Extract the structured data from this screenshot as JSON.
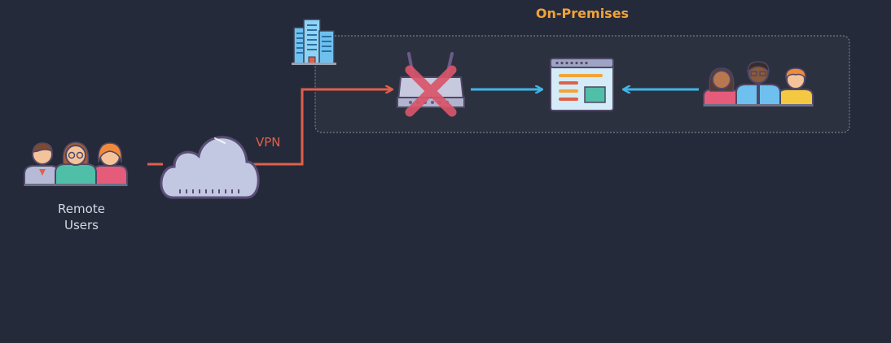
{
  "diagram": {
    "title": "On-Premises",
    "vpn_label": "VPN",
    "remote_users": {
      "line1": "Remote",
      "line2": "Users"
    }
  },
  "colors": {
    "background": "#252a3a",
    "title": "#f2a33a",
    "vpn_path": "#e0604a",
    "internal_arrows": "#3fb6e6",
    "region_border": "#8a8f9c",
    "blocked_cross": "#d9556a"
  },
  "icons": {
    "building": "building-icon",
    "router": "router-icon",
    "blocked": "blocked-cross-icon",
    "app": "application-window-icon",
    "cloud": "cloud-icon",
    "remote_group": "user-group-icon",
    "internal_group": "user-group-icon"
  }
}
